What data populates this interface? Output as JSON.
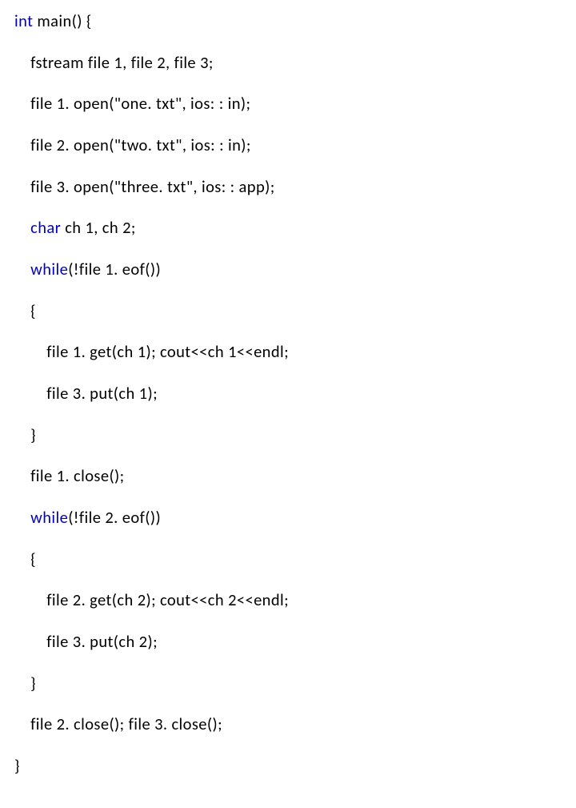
{
  "code": {
    "kw_int": "int",
    "kw_char": "char",
    "kw_while1": "while",
    "kw_while2": "while",
    "l1_rest": " main() {",
    "l2": "    fstream file 1, file 2, file 3;",
    "l3": "    file 1. open(\"one. txt\", ios: : in);",
    "l4": "    file 2. open(\"two. txt\", ios: : in);",
    "l5": "    file 3. open(\"three. txt\", ios: : app);",
    "l6_rest": " ch 1, ch 2;",
    "l6_indent": "    ",
    "l7_indent": "    ",
    "l7_rest": "(!file 1. eof())",
    "l8": "    {",
    "l9": "        file 1. get(ch 1); cout<<ch 1<<endl;",
    "l10": "        file 3. put(ch 1);",
    "l11": "    }",
    "l12": "    file 1. close();",
    "l13_indent": "    ",
    "l13_rest": "(!file 2. eof())",
    "l14": "    {",
    "l15": "        file 2. get(ch 2); cout<<ch 2<<endl;",
    "l16": "        file 3. put(ch 2);",
    "l17": "    }",
    "l18": "    file 2. close(); file 3. close();",
    "l19": "}"
  }
}
